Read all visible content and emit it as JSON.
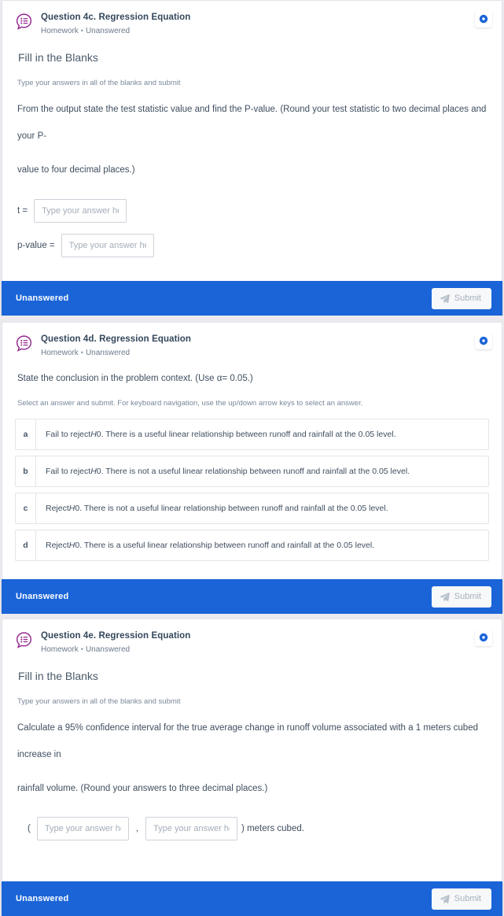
{
  "theme": {
    "page_background": "#eceaee",
    "card_background": "#ffffff",
    "footer_blue": "#1a64d8",
    "icon_purple": "#93278f",
    "badge_blue": "#1a64d8",
    "text_primary": "#3f4e5f",
    "text_muted": "#7a8899"
  },
  "common": {
    "subject": "Homework",
    "status": "Unanswered",
    "separator": "•",
    "footer_status": "Unanswered",
    "submit_label": "Submit",
    "answer_placeholder": "Type your answer here",
    "fill_blanks_heading": "Fill in the Blanks",
    "fill_blanks_hint": "Type your answers in all of the blanks and submit"
  },
  "questions": [
    {
      "id": "q4c",
      "title": "Question 4c. Regression Equation",
      "subject": "Homework",
      "status": "Unanswered",
      "heading": "Fill in the Blanks",
      "hint": "Type your answers in all of the blanks and submit",
      "prompt_line1": "From the output state the test statistic value and find the P-value. (Round your test statistic to two decimal places and your P-",
      "prompt_line2": "value to four decimal places.)",
      "blanks": [
        {
          "label": "t =",
          "value": "",
          "placeholder": "Type your answer here"
        },
        {
          "label": "p-value =",
          "value": "",
          "placeholder": "Type your answer here"
        }
      ],
      "footer_status": "Unanswered",
      "submit_label": "Submit"
    },
    {
      "id": "q4d",
      "title": "Question 4d. Regression Equation",
      "subject": "Homework",
      "status": "Unanswered",
      "prompt": "State the conclusion in the problem context. (Use α= 0.05.)",
      "hint": "Select an answer and submit. For keyboard navigation, use the up/down arrow keys to select an answer.",
      "choices": [
        {
          "letter": "a",
          "pre": "Fail to reject ",
          "italic": "H",
          "post": "0. There is a useful linear relationship between runoff and rainfall at the 0.05 level."
        },
        {
          "letter": "b",
          "pre": "Fail to reject ",
          "italic": "H",
          "post": "0. There is not a useful linear relationship between runoff and rainfall at the 0.05 level."
        },
        {
          "letter": "c",
          "pre": "Reject ",
          "italic": "H",
          "post": "0. There is not a useful linear relationship between runoff and rainfall at the 0.05 level."
        },
        {
          "letter": "d",
          "pre": "Reject ",
          "italic": "H",
          "post": "0. There is a useful linear relationship between runoff and rainfall at the 0.05 level."
        }
      ],
      "footer_status": "Unanswered",
      "submit_label": "Submit"
    },
    {
      "id": "q4e",
      "title": "Question 4e. Regression Equation",
      "subject": "Homework",
      "status": "Unanswered",
      "heading": "Fill in the Blanks",
      "hint": "Type your answers in all of the blanks and submit",
      "prompt_line1": "Calculate a 95% confidence interval for the true average change in runoff volume associated with a 1 meters cubed increase in",
      "prompt_line2": "rainfall volume. (Round your answers to three decimal places.)",
      "interval": {
        "open_paren": "(",
        "comma": ",",
        "close_text": ") meters cubed.",
        "lower": {
          "value": "",
          "placeholder": "Type your answer here"
        },
        "upper": {
          "value": "",
          "placeholder": "Type your answer here"
        }
      },
      "footer_status": "Unanswered",
      "submit_label": "Submit"
    }
  ],
  "icons": {
    "question_bubble": "question-bubble-icon",
    "info_badge": "info-circle-icon",
    "submit": "paper-plane-icon"
  }
}
